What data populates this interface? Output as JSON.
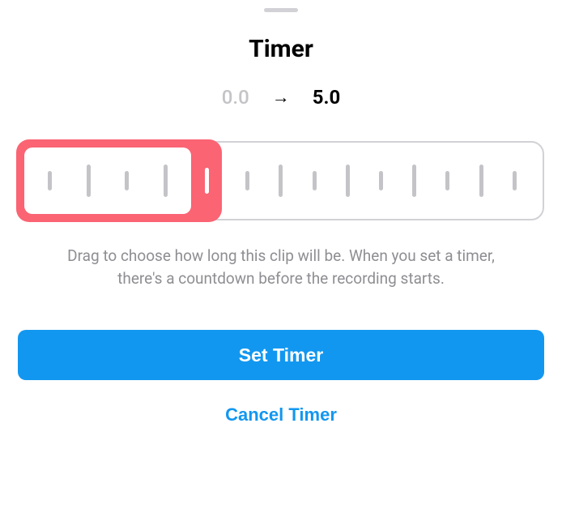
{
  "title": "Timer",
  "range": {
    "start": "0.0",
    "end": "5.0"
  },
  "helpText": "Drag to choose how long this clip will be. When you set a timer, there's a countdown before the recording starts.",
  "buttons": {
    "primary": "Set Timer",
    "secondary": "Cancel Timer"
  },
  "slider": {
    "max": 15.0,
    "selected": 5.0
  }
}
